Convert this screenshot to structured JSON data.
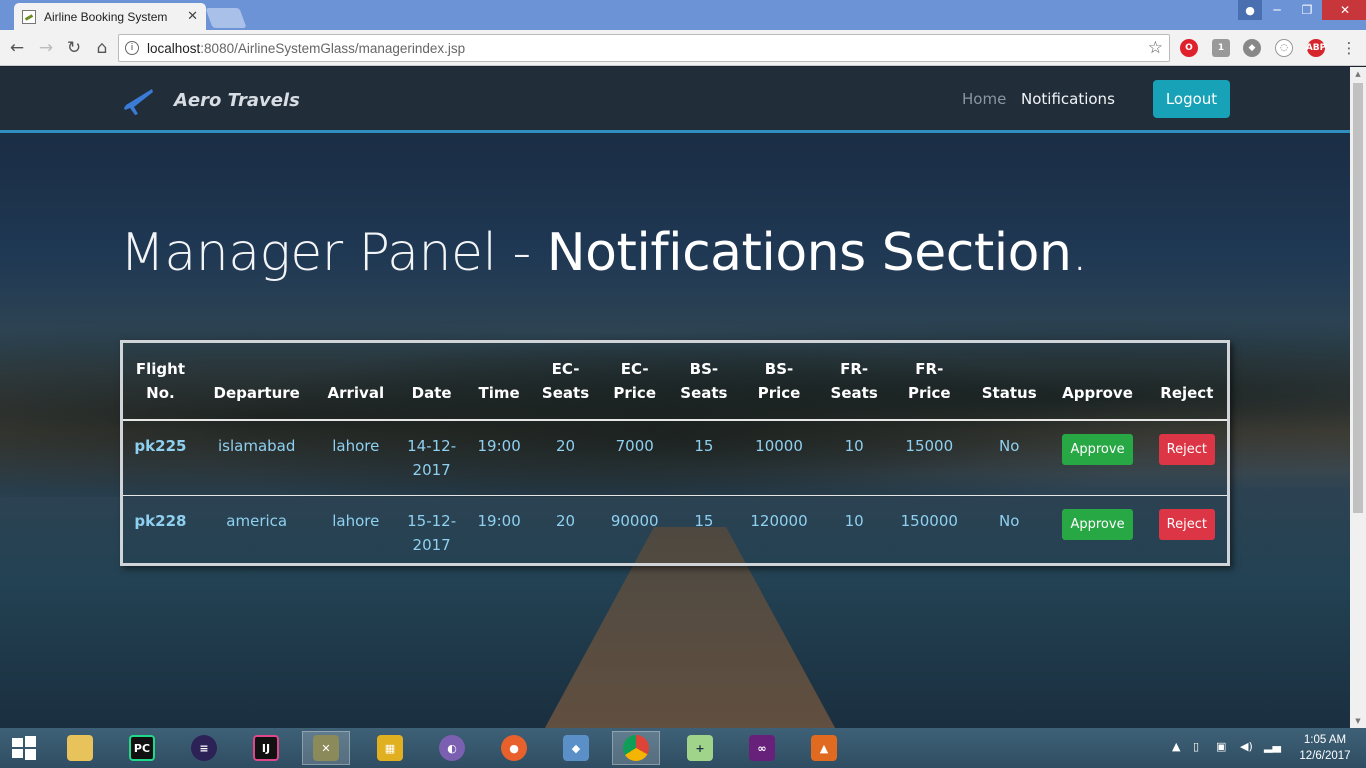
{
  "browser": {
    "tab_title": "Airline Booking System",
    "tab_close": "✕",
    "url_host": "localhost",
    "url_path": ":8080/AirlineSystemGlass/managerindex.jsp",
    "window_min": "─",
    "window_max": "❐",
    "window_close": "✕"
  },
  "navbar": {
    "brand": "Aero Travels",
    "home": "Home",
    "notifications": "Notifications",
    "logout": "Logout"
  },
  "page": {
    "title_light": "Manager Panel - ",
    "title_bold": "Notifications Section",
    "title_end": "."
  },
  "table": {
    "headers": [
      [
        "Flight",
        "No."
      ],
      [
        "",
        "Departure"
      ],
      [
        "",
        "Arrival"
      ],
      [
        "",
        "Date"
      ],
      [
        "",
        "Time"
      ],
      [
        "EC-",
        "Seats"
      ],
      [
        "EC-",
        "Price"
      ],
      [
        "BS-",
        "Seats"
      ],
      [
        "BS-",
        "Price"
      ],
      [
        "FR-",
        "Seats"
      ],
      [
        "FR-",
        "Price"
      ],
      [
        "",
        "Status"
      ],
      [
        "",
        "Approve"
      ],
      [
        "",
        "Reject"
      ]
    ],
    "rows": [
      {
        "flight": "pk225",
        "departure": "islamabad",
        "arrival": "lahore",
        "date1": "14-12-",
        "date2": "2017",
        "time": "19:00",
        "ec_seats": "20",
        "ec_price": "7000",
        "bs_seats": "15",
        "bs_price": "10000",
        "fr_seats": "10",
        "fr_price": "15000",
        "status": "No",
        "approve": "Approve",
        "reject": "Reject"
      },
      {
        "flight": "pk228",
        "departure": "america",
        "arrival": "lahore",
        "date1": "15-12-",
        "date2": "2017",
        "time": "19:00",
        "ec_seats": "20",
        "ec_price": "90000",
        "bs_seats": "15",
        "bs_price": "120000",
        "fr_seats": "10",
        "fr_price": "150000",
        "status": "No",
        "approve": "Approve",
        "reject": "Reject"
      }
    ]
  },
  "taskbar": {
    "time": "1:05 AM",
    "date": "12/6/2017",
    "apps": [
      "windows-start-icon",
      "file-explorer-icon",
      "pycharm-icon",
      "eclipse-icon",
      "intellij-icon",
      "tools-icon",
      "cube-app-icon",
      "torrent-icon",
      "firefox-icon",
      "virtualbox-icon",
      "chrome-icon",
      "notepad-plus-icon",
      "visual-studio-icon",
      "matlab-icon"
    ]
  },
  "colors": {
    "accent": "#17a2b8",
    "approve": "#28a745",
    "reject": "#dc3545",
    "cell_text": "#8fd0f0"
  }
}
